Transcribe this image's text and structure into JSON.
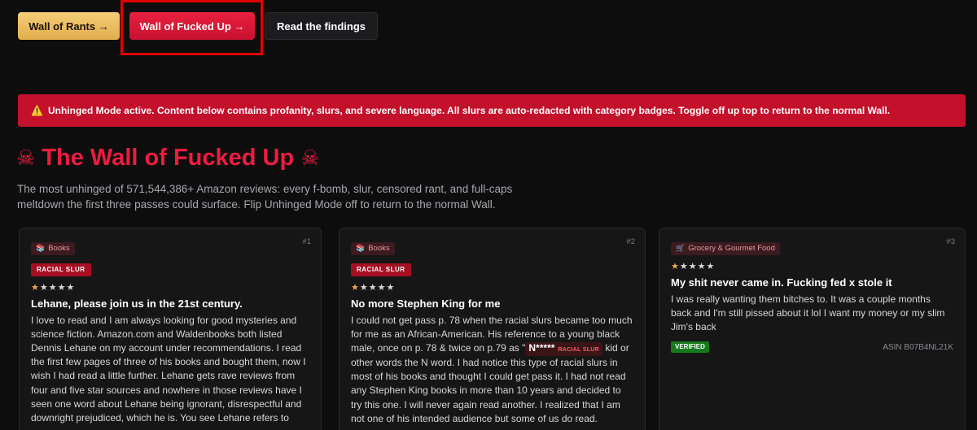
{
  "nav": {
    "rants_label": "Wall of Rants →",
    "fucked_label": "Wall of Fucked Up →",
    "findings_label": "Read the findings"
  },
  "warning": {
    "icon": "warning-icon",
    "text": "Unhinged Mode active. Content below contains profanity, slurs, and severe language. All slurs are auto-redacted with category badges. Toggle off up top to return to the normal Wall."
  },
  "header": {
    "skull_left": "☠",
    "title": "The Wall of Fucked Up",
    "skull_right": "☠",
    "subtitle": "The most unhinged of 571,544,386+ Amazon reviews: every f-bomb, slur, censored rant, and full-caps meltdown the first three passes could surface. Flip Unhinged Mode off to return to the normal Wall."
  },
  "colors": {
    "accent_red": "#ee1c3f",
    "warning_bg": "#c3102b",
    "gold": "#f4cd76",
    "verified_green": "#157a1d"
  },
  "cards": [
    {
      "number": "#1",
      "category_icon": "book-icon",
      "category": "Books",
      "badge": "RACIAL SLUR",
      "rating": 1,
      "star_filled": "★",
      "star_empty": "★★★★",
      "title": "Lehane, please join us in the 21st century.",
      "body": "I love to read and I am always looking for good mysteries and science fiction.  Amazon.com and Waldenbooks both listed Dennis Lehane on my account under recommendations.  I read the first few pages of three of his books and bought them, now I wish I had read a little further.  Lehane gets  rave reviews from four and five star sources and nowhere in those reviews have I  seen one word about Lehane being ignorant, disrespectful and downright  prejudiced, which he is.  You see Lehane refers to"
    },
    {
      "number": "#2",
      "category_icon": "book-icon",
      "category": "Books",
      "badge": "RACIAL SLUR",
      "rating": 1,
      "star_filled": "★",
      "star_empty": "★★★★",
      "title": "No more Stephen King for me",
      "body_before": "I could not get pass p. 78 when the racial slurs became too much for me as an African-American. His reference to a young black male, once on p. 78 & twice on p.79 as \"",
      "redacted": "N*****",
      "redacted_tag": "RACIAL SLUR",
      "body_after": " kid or other words the N word. I had notice this type of racial slurs in most of his books and thought I could get pass it. I had not read any Stephen King books in more than 10 years and decided to try this one. I will never again read another. I realized that I am not one of his intended audience but some of us do read."
    },
    {
      "number": "#3",
      "category_icon": "grocery-icon",
      "category": "Grocery & Gourmet Food",
      "rating": 1,
      "star_filled": "★",
      "star_empty": "★★★★",
      "title": "My shit never came in. Fucking fed x stole it",
      "body": "I was really wanting them bitches to. It was a couple months back and I'm still pissed about it lol I want my money or my slim Jim's back",
      "verified": "VERIFIED",
      "asin": "ASIN B07B4NL21K"
    }
  ]
}
